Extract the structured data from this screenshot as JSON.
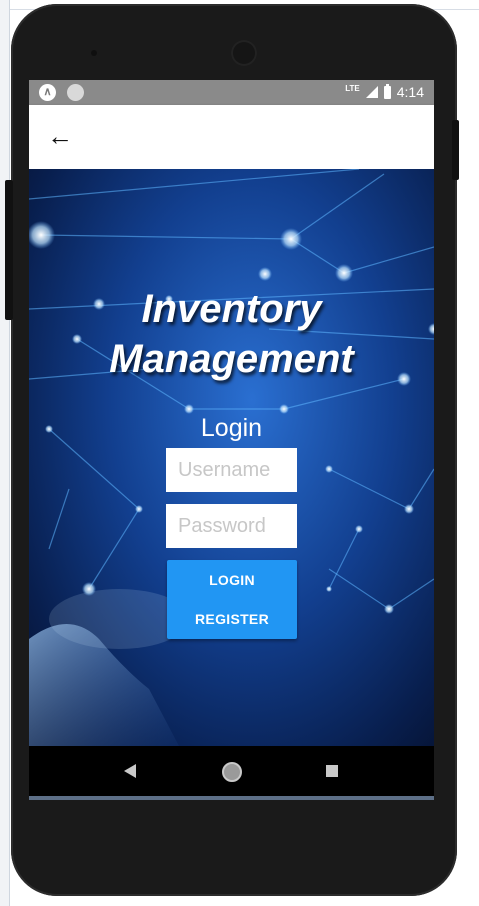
{
  "statusbar": {
    "left_icons": [
      "android-notification-icon",
      "circle-notification-icon"
    ],
    "network": "LTE",
    "time": "4:14"
  },
  "appbar": {
    "back_icon": "arrow-left-icon"
  },
  "login_screen": {
    "title_line1": "Inventory",
    "title_line2": "Management",
    "login_label": "Login",
    "username_placeholder": "Username",
    "password_placeholder": "Password",
    "login_button": "LOGIN",
    "register_button": "REGISTER",
    "button_color": "#2196f3"
  },
  "navbar": {
    "icons": [
      "nav-back-icon",
      "nav-home-icon",
      "nav-recents-icon"
    ]
  }
}
